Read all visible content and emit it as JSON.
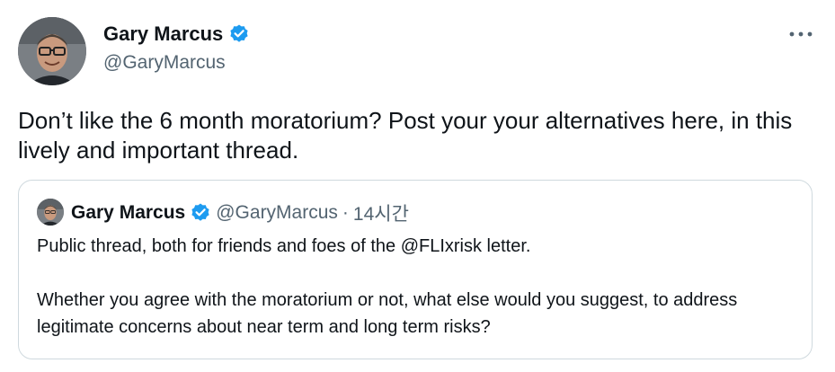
{
  "author": {
    "name": "Gary Marcus",
    "handle": "@GaryMarcus"
  },
  "tweet": {
    "text": "Don’t like the 6 month moratorium? Post your your alternatives here, in this lively and important thread."
  },
  "quoted": {
    "name": "Gary Marcus",
    "handle": "@GaryMarcus",
    "separator": "·",
    "time": "14시간",
    "paragraph1": "Public thread, both for friends and foes of the @FLIxrisk letter.",
    "paragraph2": "Whether you agree with the moratorium or not, what else would you suggest, to address legitimate concerns about near term and long term risks?"
  },
  "icons": {
    "verified": "verified-badge-icon",
    "more": "more-options-icon"
  },
  "colors": {
    "text": "#0f1419",
    "secondary": "#536471",
    "verified": "#1d9bf0",
    "border": "#cfd9de"
  }
}
